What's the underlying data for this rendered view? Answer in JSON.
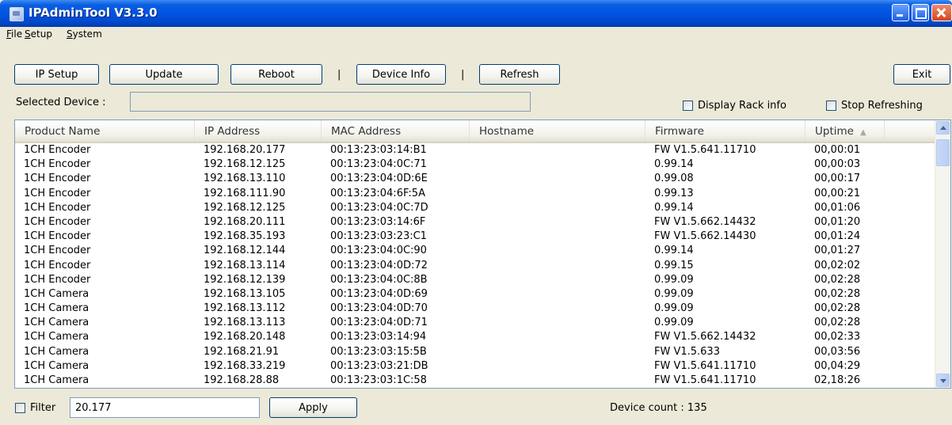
{
  "window": {
    "title": "IPAdminTool V3.3.0"
  },
  "menu": [
    "File",
    "Setup",
    "System"
  ],
  "toolbar": {
    "ip_setup": "IP Setup",
    "update": "Update",
    "reboot": "Reboot",
    "device_info": "Device Info",
    "refresh": "Refresh",
    "exit": "Exit",
    "separator": "|"
  },
  "selected_device": {
    "label": "Selected Device :",
    "value": ""
  },
  "options": {
    "display_rack_info": {
      "label": "Display Rack info",
      "checked": false
    },
    "stop_refreshing": {
      "label": "Stop Refreshing",
      "checked": false
    }
  },
  "columns": [
    "Product Name",
    "IP Address",
    "MAC Address",
    "Hostname",
    "Firmware",
    "Uptime"
  ],
  "sort": {
    "column": "Uptime",
    "direction": "ascending"
  },
  "rows": [
    [
      "1CH Encoder",
      "192.168.20.177",
      "00:13:23:03:14:B1",
      "",
      "FW V1.5.641.11710",
      "00,00:01"
    ],
    [
      "1CH Encoder",
      "192.168.12.125",
      "00:13:23:04:0C:71",
      "",
      "0.99.14",
      "00,00:03"
    ],
    [
      "1CH Encoder",
      "192.168.13.110",
      "00:13:23:04:0D:6E",
      "",
      "0.99.08",
      "00,00:17"
    ],
    [
      "1CH Encoder",
      "192.168.111.90",
      "00:13:23:04:6F:5A",
      "",
      "0.99.13",
      "00,00:21"
    ],
    [
      "1CH Encoder",
      "192.168.12.125",
      "00:13:23:04:0C:7D",
      "",
      "0.99.14",
      "00,01:06"
    ],
    [
      "1CH Encoder",
      "192.168.20.111",
      "00:13:23:03:14:6F",
      "",
      "FW V1.5.662.14432",
      "00,01:20"
    ],
    [
      "1CH Encoder",
      "192.168.35.193",
      "00:13:23:03:23:C1",
      "",
      "FW V1.5.662.14430",
      "00,01:24"
    ],
    [
      "1CH Encoder",
      "192.168.12.144",
      "00:13:23:04:0C:90",
      "",
      "0.99.14",
      "00,01:27"
    ],
    [
      "1CH Encoder",
      "192.168.13.114",
      "00:13:23:04:0D:72",
      "",
      "0.99.15",
      "00,02:02"
    ],
    [
      "1CH Encoder",
      "192.168.12.139",
      "00:13:23:04:0C:8B",
      "",
      "0.99.09",
      "00,02:28"
    ],
    [
      "1CH Camera",
      "192.168.13.105",
      "00:13:23:04:0D:69",
      "",
      "0.99.09",
      "00,02:28"
    ],
    [
      "1CH Camera",
      "192.168.13.112",
      "00:13:23:04:0D:70",
      "",
      "0.99.09",
      "00,02:28"
    ],
    [
      "1CH Camera",
      "192.168.13.113",
      "00:13:23:04:0D:71",
      "",
      "0.99.09",
      "00,02:28"
    ],
    [
      "1CH Camera",
      "192.168.20.148",
      "00:13:23:03:14:94",
      "",
      "FW V1.5.662.14432",
      "00,02:33"
    ],
    [
      "1CH Camera",
      "192.168.21.91",
      "00:13:23:03:15:5B",
      "",
      "FW V1.5.633",
      "00,03:56"
    ],
    [
      "1CH Camera",
      "192.168.33.219",
      "00:13:23:03:21:DB",
      "",
      "FW V1.5.641.11710",
      "00,04:29"
    ],
    [
      "1CH Camera",
      "192.168.28.88",
      "00:13:23:03:1C:58",
      "",
      "FW V1.5.641.11710",
      "02,18:26"
    ]
  ],
  "filter": {
    "label": "Filter",
    "checked": false,
    "value": "20.177",
    "apply": "Apply"
  },
  "status": {
    "device_count": "Device count : 135"
  },
  "colors": {
    "titlebar": "#0054e3",
    "window_bg": "#ece9d8",
    "button_border": "#003c74"
  }
}
